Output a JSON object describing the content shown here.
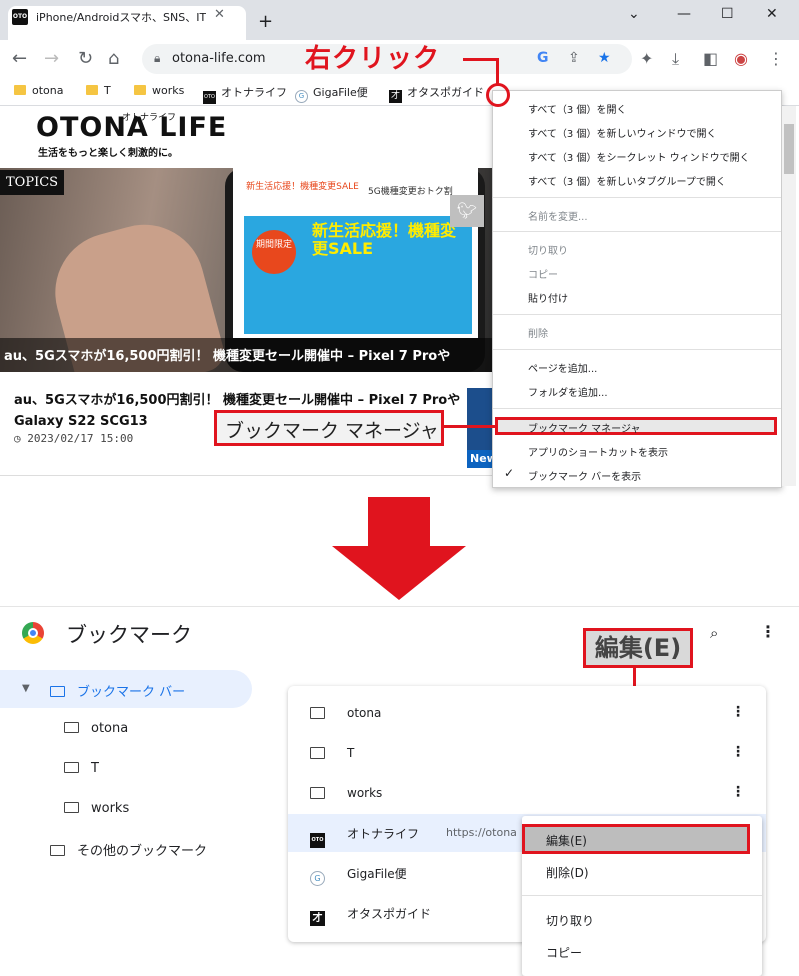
{
  "browser": {
    "tab_title": "iPhone/Androidスマホ、SNS、IT/パ",
    "tab_favicon": "OTO",
    "url": "otona-life.com"
  },
  "bookmarks_bar": [
    {
      "label": "otona",
      "type": "folder"
    },
    {
      "label": "T",
      "type": "folder"
    },
    {
      "label": "works",
      "type": "folder"
    },
    {
      "label": "オトナライフ",
      "type": "site"
    },
    {
      "label": "GigaFile便",
      "type": "site"
    },
    {
      "label": "オタスポガイド",
      "type": "site"
    }
  ],
  "site": {
    "logo": "OTONA LIFE",
    "logo_kana": "オトナライフ",
    "tagline": "生活をもっと楽しく刺激的に。",
    "topics_badge": "TOPICS",
    "hero_tab1": "新生活応援！機種変更SALE",
    "hero_tab2": "5G機種変更おトク割",
    "hero_sale": "新生活応援！機種変更SALE",
    "hero_badge": "期間限定",
    "hero_caption": "au、5Gスマホが16,500円割引！ 機種変更セール開催中 – Pixel 7 Proや",
    "article_title": "au、5Gスマホが16,500円割引！ 機種変更セール開催中 – Pixel 7 ProやGalaxy S22 SCG13",
    "article_date": "2023/02/17 15:00",
    "thumb_label": "New"
  },
  "context_menu": {
    "items": [
      "すべて（3 個）を開く",
      "すべて（3 個）を新しいウィンドウで開く",
      "すべて（3 個）をシークレット ウィンドウで開く",
      "すべて（3 個）を新しいタブグループで開く",
      "名前を変更...",
      "切り取り",
      "コピー",
      "貼り付け",
      "削除",
      "ページを追加...",
      "フォルダを追加...",
      "ブックマーク マネージャ",
      "アプリのショートカットを表示",
      "ブックマーク バーを表示"
    ]
  },
  "annotations": {
    "right_click": "右クリック",
    "bookmark_manager": "ブックマーク マネージャ",
    "edit": "編集(E)",
    "accent_color": "#e0141e"
  },
  "manager": {
    "title": "ブックマーク",
    "sidebar": [
      "ブックマーク バー",
      "otona",
      "T",
      "works",
      "その他のブックマーク"
    ],
    "list": [
      {
        "label": "otona",
        "type": "folder"
      },
      {
        "label": "T",
        "type": "folder"
      },
      {
        "label": "works",
        "type": "folder"
      },
      {
        "label": "オトナライフ",
        "type": "site",
        "url": "https://otona"
      },
      {
        "label": "GigaFile便",
        "type": "site"
      },
      {
        "label": "オタスポガイド",
        "type": "site"
      }
    ],
    "row_menu": [
      "編集(E)",
      "削除(D)",
      "切り取り",
      "コピー"
    ]
  }
}
